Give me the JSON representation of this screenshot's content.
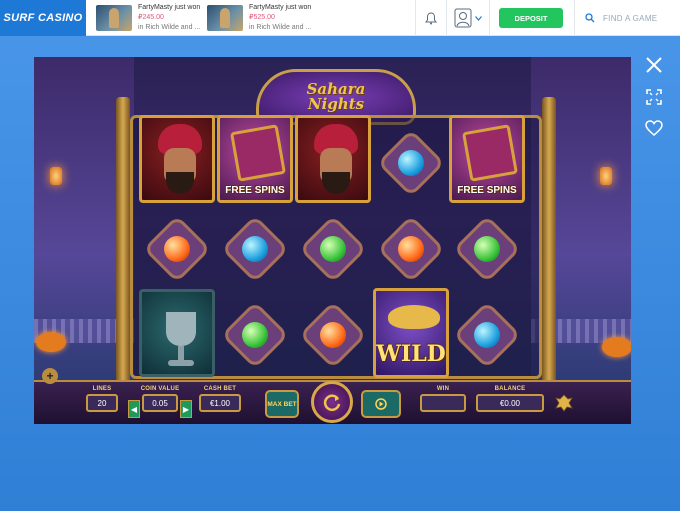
{
  "header": {
    "logo": "SURF CASINO",
    "winners": [
      {
        "name": "FartyMasty just won",
        "amount": "₽245.00",
        "game": "in Rich Wilde and ..."
      },
      {
        "name": "FartyMasty just won",
        "amount": "₽525.00",
        "game": "in Rich Wilde and ..."
      }
    ],
    "deposit_label": "DEPOSIT",
    "search_placeholder": "FIND A GAME"
  },
  "game": {
    "title_line1": "Sahara",
    "title_line2": "Nights",
    "symbol_labels": {
      "free_spins": "FREE SPINS",
      "wild": "WILD"
    },
    "controls": {
      "lines_label": "LINES",
      "lines_value": "20",
      "coin_value_label": "COIN VALUE",
      "coin_value": "0.05",
      "cash_bet_label": "CASH BET",
      "cash_bet": "€1.00",
      "max_bet_label": "MAX BET",
      "win_label": "WIN",
      "win_value": "",
      "balance_label": "BALANCE",
      "balance_value": "€0.00"
    }
  },
  "colors": {
    "brand": "#1e78d6",
    "deposit": "#22c55e",
    "gold": "#c99a3f"
  }
}
